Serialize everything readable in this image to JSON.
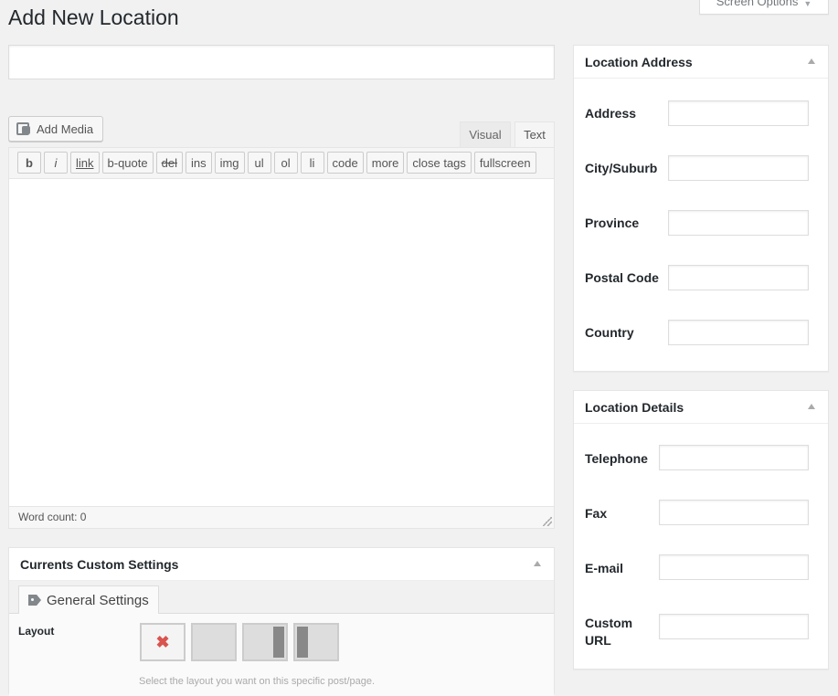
{
  "page": {
    "title": "Add New Location",
    "screen_options_label": "Screen Options",
    "screen_options_caret": "▼"
  },
  "title_input": {
    "value": "",
    "placeholder": ""
  },
  "editor": {
    "add_media_label": "Add Media",
    "tabs": {
      "visual": "Visual",
      "text": "Text"
    },
    "quicktags": [
      "b",
      "i",
      "link",
      "b-quote",
      "del",
      "ins",
      "img",
      "ul",
      "ol",
      "li",
      "code",
      "more",
      "close tags",
      "fullscreen"
    ],
    "word_count": "Word count: 0"
  },
  "location_address": {
    "title": "Location Address",
    "fields": [
      "Address",
      "City/Suburb",
      "Province",
      "Postal Code",
      "Country"
    ]
  },
  "location_details": {
    "title": "Location Details",
    "fields": [
      "Telephone",
      "Fax",
      "E-mail",
      "Custom URL"
    ]
  },
  "custom_settings": {
    "title": "Currents Custom Settings",
    "tab_label": "General Settings",
    "layout_label": "Layout",
    "help_text": "Select the layout you want on this specific post/page."
  },
  "icons": {
    "media": "add-media-icon",
    "tag": "tag-icon",
    "toggle": "toggle-arrow-icon",
    "no_layout": "close-icon"
  },
  "colors": {
    "accent_red": "#d9534f",
    "background": "#f1f1f1"
  }
}
